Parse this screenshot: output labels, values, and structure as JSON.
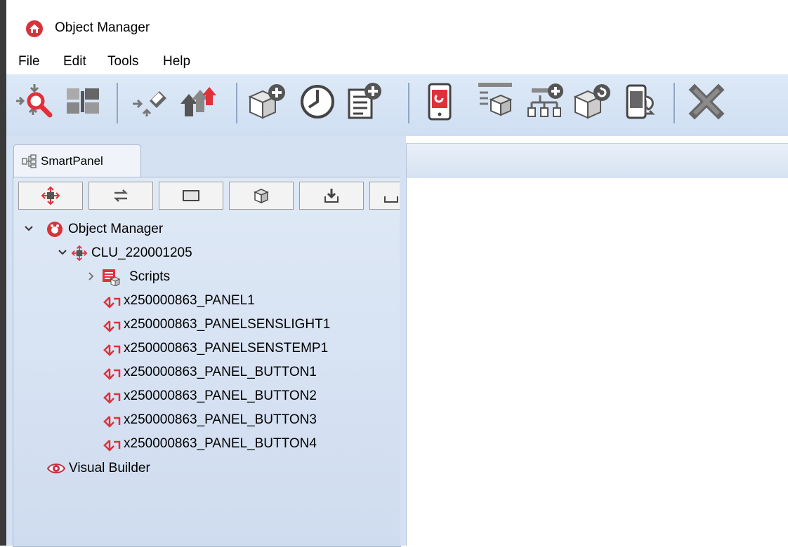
{
  "window": {
    "title": "Object Manager"
  },
  "menu": [
    "File",
    "Edit",
    "Tools",
    "Help"
  ],
  "toolbar": {
    "buttons": [
      "search-object-icon",
      "object-list-icon",
      "rename-object-icon",
      "upload-icon",
      "add-object-icon",
      "clock-icon",
      "add-document-icon",
      "mobile-app-icon",
      "device-tree-icon",
      "add-tree-icon",
      "refresh-object-icon",
      "mobile-sync-icon",
      "close-icon"
    ]
  },
  "smartpanel": {
    "tab_label": "SmartPanel",
    "buttons": [
      "clu-icon",
      "swap-icon",
      "panel-icon",
      "box-icon",
      "download-icon",
      "upload-icon"
    ]
  },
  "tree": {
    "root": "Object Manager",
    "clu": "CLU_220001205",
    "scripts": "Scripts",
    "items": [
      "x250000863_PANEL1",
      "x250000863_PANELSENSLIGHT1",
      "x250000863_PANELSENSTEMP1",
      "x250000863_PANEL_BUTTON1",
      "x250000863_PANEL_BUTTON2",
      "x250000863_PANEL_BUTTON3",
      "x250000863_PANEL_BUTTON4"
    ],
    "visual_builder": "Visual Builder"
  },
  "colors": {
    "accent": "#e0303a",
    "toolbar_bg": "#d6e3f4",
    "panel_bg": "#d4e1f2"
  }
}
